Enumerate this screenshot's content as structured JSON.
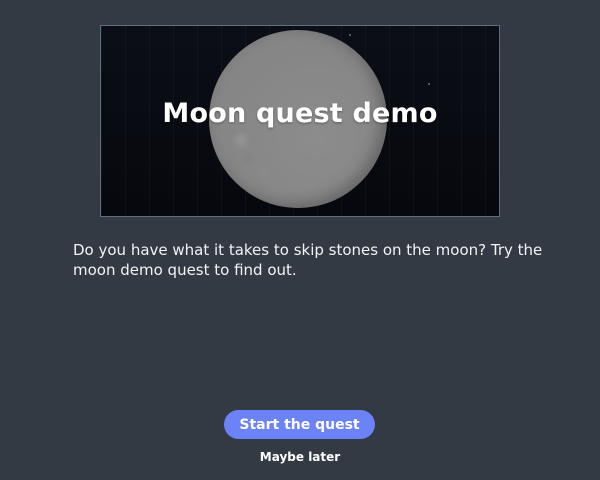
{
  "hero": {
    "title": "Moon quest demo",
    "image": "moon-image"
  },
  "description": "Do you have what it takes to skip stones on the moon? Try the moon demo quest to find out.",
  "actions": {
    "start_label": "Start the quest",
    "later_label": "Maybe later"
  },
  "colors": {
    "background": "#333a44",
    "accent_button": "#6c83f7",
    "moon": "#858585",
    "hero_background": "#090c12"
  }
}
